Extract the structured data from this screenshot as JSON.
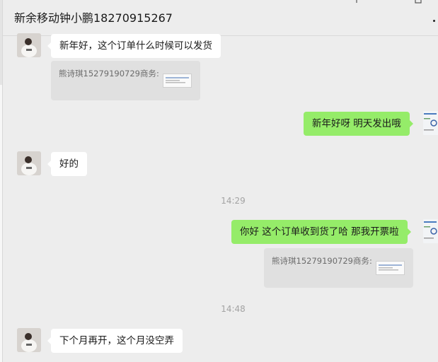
{
  "header": {
    "title": "新余移动钟小鹏18270915267"
  },
  "messages": {
    "m1": {
      "text": "新年好，这个订单什么时候可以发货"
    },
    "q1": {
      "text": "熊诗琪15279190729商务:"
    },
    "m2": {
      "text": "新年好呀 明天发出哦"
    },
    "m3": {
      "text": "好的"
    },
    "t1": {
      "text": "14:29"
    },
    "m4": {
      "text": "你好 这个订单收到货了哈 那我开票啦"
    },
    "q2": {
      "text": "熊诗琪15279190729商务:"
    },
    "t2": {
      "text": "14:48"
    },
    "m5": {
      "text": "下个月再开，这个月没空弄"
    }
  },
  "colors": {
    "background": "#ededed",
    "incoming_bubble": "#ffffff",
    "outgoing_bubble": "#95ec69",
    "quote_block": "#e0e0e0",
    "timestamp": "#a3a3a3"
  },
  "icons": {
    "contact_avatar": "avatar-icon",
    "self_avatar": "avatar-icon",
    "quote_attachment": "image-thumbnail-icon",
    "more": "more-icon"
  }
}
